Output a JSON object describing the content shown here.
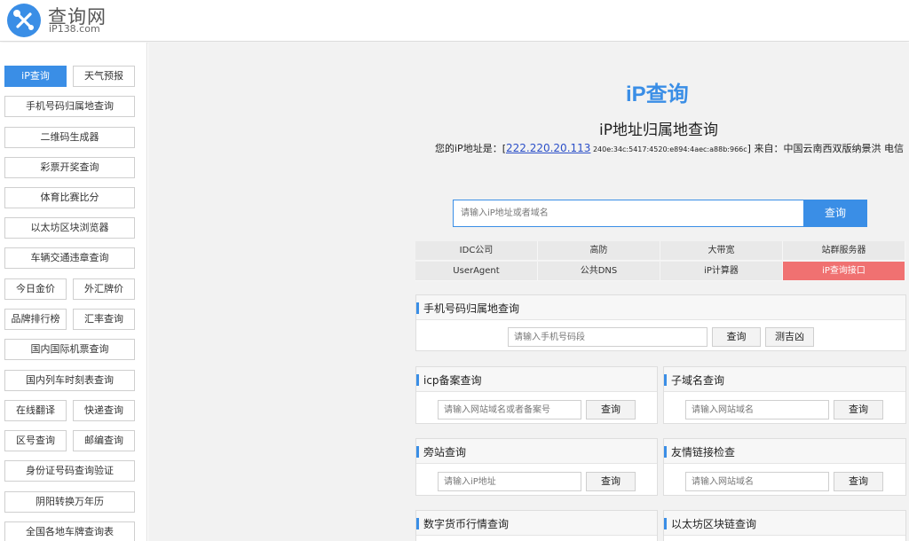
{
  "header": {
    "site_title": "查询网",
    "site_domain": "iP138.com",
    "logo_icon": "wrench-screwdriver-icon"
  },
  "sidebar": {
    "items": [
      {
        "label": "iP查询",
        "active": true
      },
      {
        "label": "天气预报"
      },
      {
        "label": "手机号码归属地查询"
      },
      {
        "label": "二维码生成器"
      },
      {
        "label": "彩票开奖查询"
      },
      {
        "label": "体育比赛比分"
      },
      {
        "label": "以太坊区块浏览器"
      },
      {
        "label": "车辆交通违章查询"
      },
      {
        "label": "今日金价"
      },
      {
        "label": "外汇牌价"
      },
      {
        "label": "品牌排行榜"
      },
      {
        "label": "汇率查询"
      },
      {
        "label": "国内国际机票查询"
      },
      {
        "label": "国内列车时刻表查询"
      },
      {
        "label": "在线翻译"
      },
      {
        "label": "快递查询"
      },
      {
        "label": "区号查询"
      },
      {
        "label": "邮编查询"
      },
      {
        "label": "身份证号码查询验证"
      },
      {
        "label": "阴阳转换万年历"
      },
      {
        "label": "全国各地车牌查询表"
      }
    ]
  },
  "main": {
    "ip_logo": "iP查询",
    "title": "iP地址归属地查询",
    "ip_prefix": "您的iP地址是：[",
    "ip_address": "222.220.20.113",
    "ipv6": " 240e:34c:5417:4520:e894:4aec:a88b:966c",
    "ip_suffix": "] 来自：中国云南西双版纳景洪 电信",
    "search_placeholder": "请输入iP地址或者域名",
    "search_button": "查询",
    "grid": [
      {
        "label": "IDC公司"
      },
      {
        "label": "高防"
      },
      {
        "label": "大带宽"
      },
      {
        "label": "站群服务器"
      },
      {
        "label": "UserAgent"
      },
      {
        "label": "公共DNS"
      },
      {
        "label": "iP计算器"
      },
      {
        "label": "iP查询接口",
        "highlight": true
      }
    ],
    "highlight_color": "#f07171",
    "accent_color": "#3a8ee6"
  },
  "panels": {
    "phone": {
      "title": "手机号码归属地查询",
      "placeholder": "请输入手机号码段",
      "button": "查询",
      "button2": "测吉凶"
    },
    "icp": {
      "title": "icp备案查询",
      "placeholder": "请输入网站域名或者备案号",
      "button": "查询"
    },
    "subdomain": {
      "title": "子域名查询",
      "placeholder": "请输入网站域名",
      "button": "查询"
    },
    "sidesite": {
      "title": "旁站查询",
      "placeholder": "请输入iP地址",
      "button": "查询"
    },
    "friendlink": {
      "title": "友情链接检查",
      "placeholder": "请输入网站域名",
      "button": "查询"
    },
    "crypto": {
      "title": "数字货币行情查询"
    },
    "eth": {
      "title": "以太坊区块链查询"
    }
  }
}
